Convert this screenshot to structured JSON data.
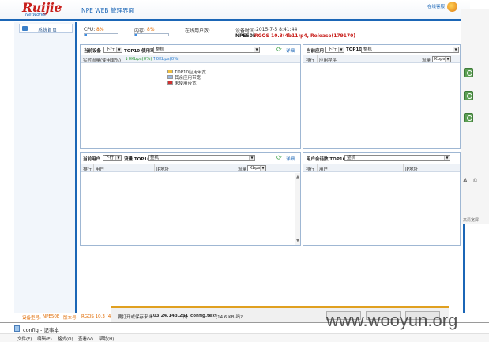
{
  "header": {
    "logo": "Ruijie",
    "logo_sub": "Networks",
    "title": "NPE WEB  管理界面",
    "online_help": "在线客服"
  },
  "sidebar": {
    "home_label": "系统首页"
  },
  "status": {
    "cpu_label": "CPU:",
    "cpu_value": "8%",
    "cpu_fill": 0.08,
    "mem_label": "内存:",
    "mem_value": "8%",
    "mem_fill": 0.08,
    "online_users_label": "在线用户数:",
    "online_users_value": "",
    "device_time_label": "设备时间:",
    "device_time_value": "2015-7-5 8:41:44",
    "device_model": "NPE50E",
    "firmware": "RGOS 10.3(4b11)p4, Release(179170)"
  },
  "panel_top_left": {
    "label": "当前设备",
    "dropdown_value": "下行",
    "top_label": "TOP10 使用率",
    "select_value": "整机",
    "detail": "详细",
    "realtime_label": "实时流量(使用率%)",
    "down_label": "↓0Kbps(0%)",
    "up_label": "↑0Kbps(0%)",
    "legend": [
      {
        "label": "TOP10应用带宽",
        "color": "#f0c040"
      },
      {
        "label": "其余应用带宽",
        "color": "#9ab8e0"
      },
      {
        "label": "未使用带宽",
        "color": "#d03030"
      }
    ]
  },
  "panel_top_right": {
    "label": "当前应用",
    "dropdown_value": "下行",
    "top_label": "TOP10",
    "select_value": "整机",
    "flow_label": "流量",
    "flow_unit": "Kbps",
    "col_rank": "排行",
    "col_app": "应用程序"
  },
  "panel_bottom_left": {
    "label": "当前用户",
    "dropdown_value": "下行",
    "top_label": "流量 TOP10",
    "select_value": "整机",
    "detail": "详细",
    "col_rank": "排行",
    "col_user": "用户",
    "col_ip": "IP地址",
    "flow_label": "流量",
    "flow_unit": "Kbps"
  },
  "panel_bottom_right": {
    "label": "用户会话数 TOP10",
    "select_value": "整机",
    "col_rank": "排行",
    "col_user": "用户",
    "col_ip": "IP地址"
  },
  "footer": {
    "device_model_label": "设备型号:",
    "device_model_value": "NPE50E",
    "version_label": "版本号:",
    "version_value": "RGOS 10.3 (4"
  },
  "download_bar": {
    "text_prefix": "要打开或保存来自",
    "host": "103.24.143.251",
    "text_mid": "的",
    "filename": "config.text",
    "size": "(14.6 KB)吗?"
  },
  "notepad": {
    "title": "config - 记事本",
    "menu": [
      "文件(F)",
      "编辑(E)",
      "格式(O)",
      "查看(V)",
      "帮助(H)"
    ]
  },
  "right_sidebar": {
    "text": "高清宽屏"
  },
  "watermark": "www.wooyun.org"
}
